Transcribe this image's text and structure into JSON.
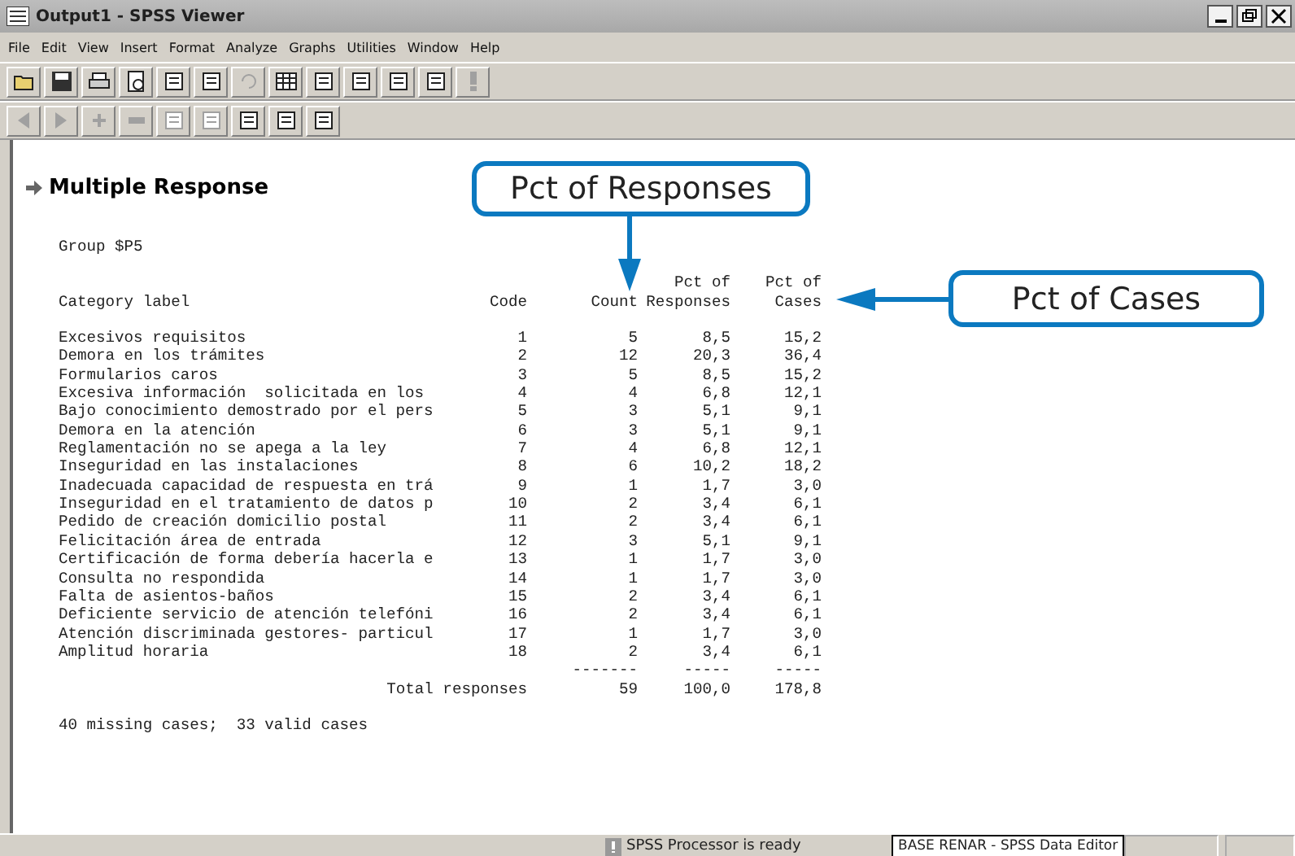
{
  "window": {
    "title": "Output1 - SPSS Viewer"
  },
  "menu": [
    "File",
    "Edit",
    "View",
    "Insert",
    "Format",
    "Analyze",
    "Graphs",
    "Utilities",
    "Window",
    "Help"
  ],
  "output": {
    "heading": "Multiple Response",
    "group": "Group $P5",
    "columns": [
      {
        "lines": [
          "Category label"
        ]
      },
      {
        "lines": [
          "Code"
        ]
      },
      {
        "lines": [
          "Count"
        ]
      },
      {
        "lines": [
          "Pct of",
          "Responses"
        ]
      },
      {
        "lines": [
          "Pct of",
          "Cases"
        ]
      }
    ],
    "rows": [
      {
        "label": "Excesivos requisitos",
        "code": "1",
        "count": "5",
        "pct_responses": "8,5",
        "pct_cases": "15,2"
      },
      {
        "label": "Demora en los trámites",
        "code": "2",
        "count": "12",
        "pct_responses": "20,3",
        "pct_cases": "36,4"
      },
      {
        "label": "Formularios caros",
        "code": "3",
        "count": "5",
        "pct_responses": "8,5",
        "pct_cases": "15,2"
      },
      {
        "label": "Excesiva información  solicitada en los",
        "code": "4",
        "count": "4",
        "pct_responses": "6,8",
        "pct_cases": "12,1"
      },
      {
        "label": "Bajo conocimiento demostrado por el pers",
        "code": "5",
        "count": "3",
        "pct_responses": "5,1",
        "pct_cases": "9,1"
      },
      {
        "label": "Demora en la atención",
        "code": "6",
        "count": "3",
        "pct_responses": "5,1",
        "pct_cases": "9,1"
      },
      {
        "label": "Reglamentación no se apega a la ley",
        "code": "7",
        "count": "4",
        "pct_responses": "6,8",
        "pct_cases": "12,1"
      },
      {
        "label": "Inseguridad en las instalaciones",
        "code": "8",
        "count": "6",
        "pct_responses": "10,2",
        "pct_cases": "18,2"
      },
      {
        "label": "Inadecuada capacidad de respuesta en trá",
        "code": "9",
        "count": "1",
        "pct_responses": "1,7",
        "pct_cases": "3,0"
      },
      {
        "label": "Inseguridad en el tratamiento de datos p",
        "code": "10",
        "count": "2",
        "pct_responses": "3,4",
        "pct_cases": "6,1"
      },
      {
        "label": "Pedido de creación domicilio postal",
        "code": "11",
        "count": "2",
        "pct_responses": "3,4",
        "pct_cases": "6,1"
      },
      {
        "label": "Felicitación área de entrada",
        "code": "12",
        "count": "3",
        "pct_responses": "5,1",
        "pct_cases": "9,1"
      },
      {
        "label": "Certificación de forma debería hacerla e",
        "code": "13",
        "count": "1",
        "pct_responses": "1,7",
        "pct_cases": "3,0"
      },
      {
        "label": "Consulta no respondida",
        "code": "14",
        "count": "1",
        "pct_responses": "1,7",
        "pct_cases": "3,0"
      },
      {
        "label": "Falta de asientos-baños",
        "code": "15",
        "count": "2",
        "pct_responses": "3,4",
        "pct_cases": "6,1"
      },
      {
        "label": "Deficiente servicio de atención telefóni",
        "code": "16",
        "count": "2",
        "pct_responses": "3,4",
        "pct_cases": "6,1"
      },
      {
        "label": "Atención discriminada gestores- particul",
        "code": "17",
        "count": "1",
        "pct_responses": "1,7",
        "pct_cases": "3,0"
      },
      {
        "label": "Amplitud horaria",
        "code": "18",
        "count": "2",
        "pct_responses": "3,4",
        "pct_cases": "6,1"
      }
    ],
    "separators": [
      "-------",
      "-----",
      "-----"
    ],
    "total": {
      "label": "Total responses",
      "count": "59",
      "pct_responses": "100,0",
      "pct_cases": "178,8"
    },
    "footer": "40 missing cases;  33 valid cases"
  },
  "callouts": [
    {
      "text": "Pct of Responses",
      "kind": "down"
    },
    {
      "text": "Pct of Cases",
      "kind": "left"
    }
  ],
  "status_bar": {
    "processor": "SPSS Processor  is ready",
    "data_editor": "BASE RENAR - SPSS Data Editor"
  }
}
